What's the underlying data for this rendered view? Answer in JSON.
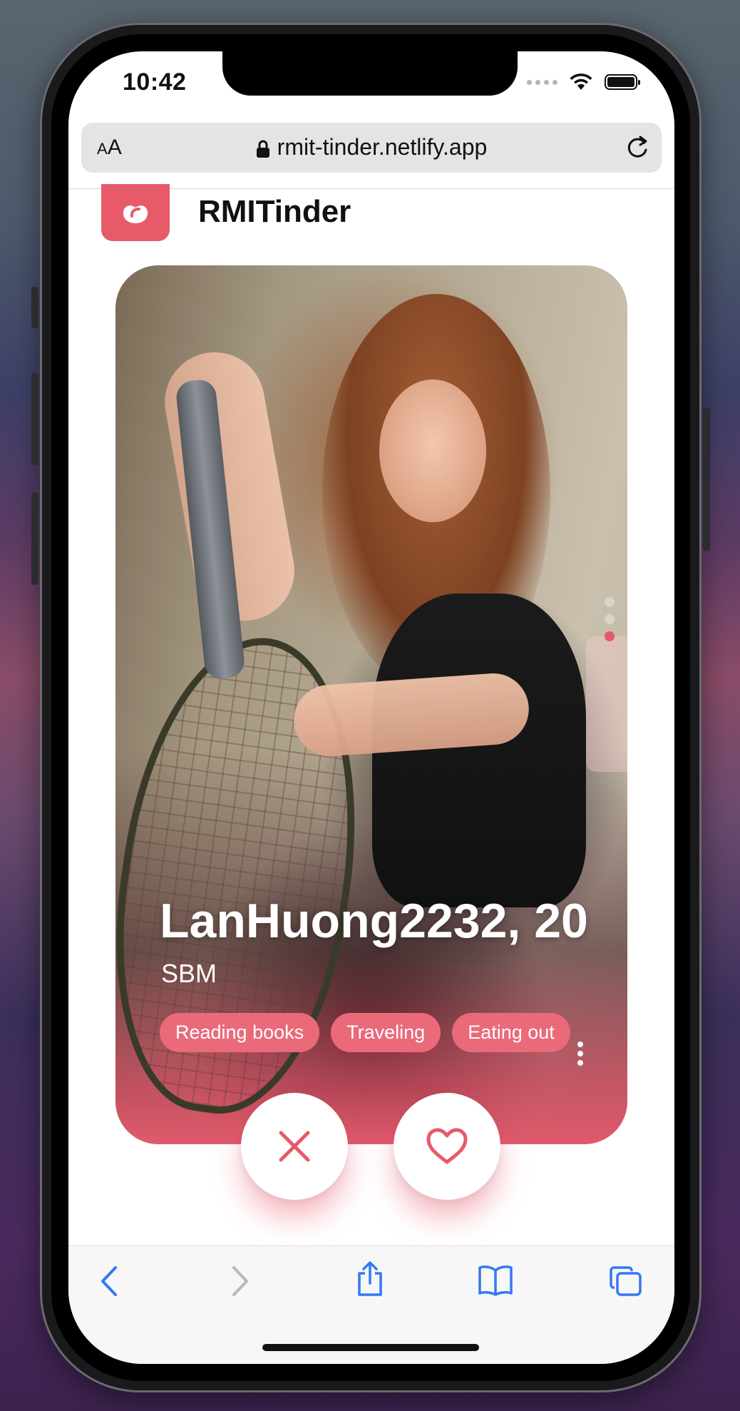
{
  "status_bar": {
    "time": "10:42"
  },
  "browser": {
    "text_size_label_small": "A",
    "text_size_label_large": "A",
    "url": "rmit-tinder.netlify.app"
  },
  "app": {
    "title": "RMITinder"
  },
  "profile": {
    "name_age": "LanHuong2232, 20",
    "school": "SBM",
    "interests": [
      "Reading books",
      "Traveling",
      "Eating out"
    ],
    "photo_index": 3,
    "photo_count": 3
  },
  "colors": {
    "accent": "#e65a6a",
    "tag_bg": "#ea6a7a",
    "toolbar_icon_active": "#3478f6",
    "toolbar_icon_disabled": "#b8b8b8"
  },
  "icons": {
    "nope": "close-icon",
    "like": "heart-icon",
    "back": "chevron-left-icon",
    "forward": "chevron-right-icon",
    "share": "share-icon",
    "bookmarks": "book-icon",
    "tabs": "tabs-icon"
  }
}
